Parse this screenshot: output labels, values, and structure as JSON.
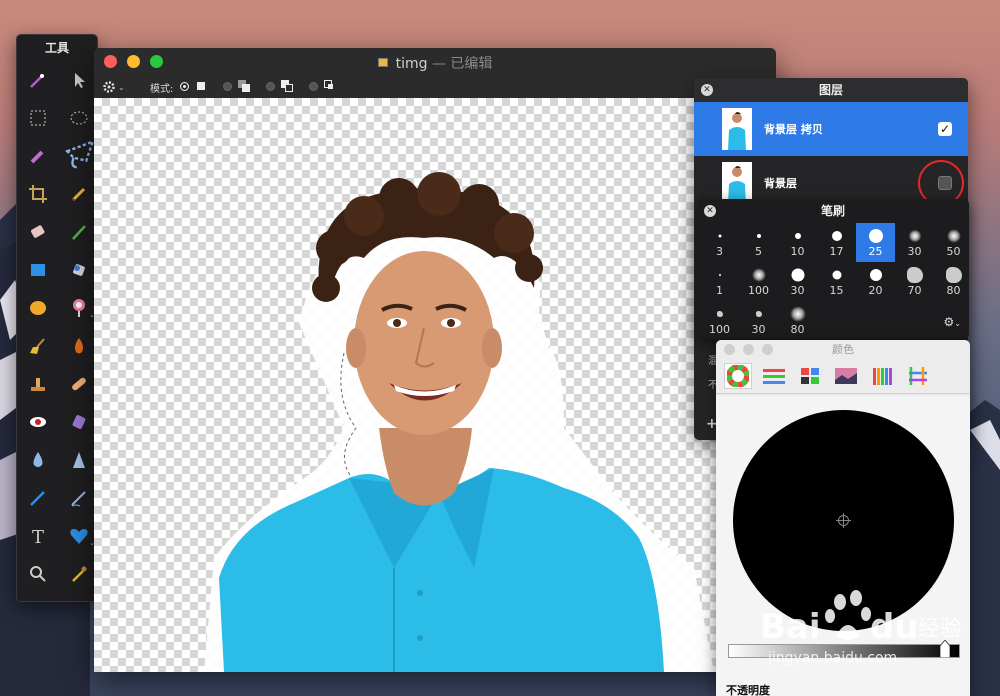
{
  "tools_palette": {
    "title": "工具",
    "tools": [
      "magic-wand-icon",
      "arrow-select-icon",
      "rect-select-icon",
      "ellipse-select-icon",
      "quick-select-icon",
      "lasso-icon",
      "crop-icon",
      "pencil-icon",
      "eraser-icon",
      "brush-icon",
      "rectangle-shape-icon",
      "fill-bucket-icon",
      "ellipse-shape-icon",
      "color-picker-lollipop-icon",
      "broom-icon",
      "burn-icon",
      "clone-stamp-icon",
      "bandage-icon",
      "red-eye-icon",
      "eraser-3d-icon",
      "blur-drop-icon",
      "sharpen-icon",
      "pen-icon",
      "smudge-icon",
      "text-icon",
      "heart-shape-icon",
      "zoom-icon",
      "eyedropper-icon"
    ]
  },
  "window": {
    "title": "timg",
    "edited_suffix": " — 已编辑",
    "options_bar": {
      "mode_label": "模式:"
    }
  },
  "layers_panel": {
    "title": "图层",
    "layers": [
      {
        "name": "背景层 拷贝",
        "visible": true,
        "selected": true
      },
      {
        "name": "背景层",
        "visible": false,
        "selected": false
      }
    ],
    "partial_labels": [
      "混",
      "不"
    ],
    "add_symbol": "+"
  },
  "brushes_panel": {
    "title": "笔刷",
    "brushes": [
      {
        "size": "3",
        "style": "hard"
      },
      {
        "size": "5",
        "style": "hard"
      },
      {
        "size": "10",
        "style": "hard"
      },
      {
        "size": "17",
        "style": "hard"
      },
      {
        "size": "25",
        "style": "hard",
        "selected": true
      },
      {
        "size": "30",
        "style": "soft"
      },
      {
        "size": "50",
        "style": "soft"
      },
      {
        "size": "1",
        "style": "hard"
      },
      {
        "size": "100",
        "style": "soft"
      },
      {
        "size": "30",
        "style": "hard"
      },
      {
        "size": "15",
        "style": "hard"
      },
      {
        "size": "20",
        "style": "hard"
      },
      {
        "size": "70",
        "style": "blob"
      },
      {
        "size": "80",
        "style": "blob"
      },
      {
        "size": "100",
        "style": "blob"
      },
      {
        "size": "30",
        "style": "blob"
      },
      {
        "size": "80",
        "style": "soft"
      }
    ],
    "gear_symbol": "⚙"
  },
  "colors_window": {
    "title": "颜色",
    "tabs": [
      "color-wheel-icon",
      "sliders-icon",
      "palettes-icon",
      "image-palette-icon",
      "crayons-icon",
      "pencils-icon"
    ],
    "current_color": "#000000",
    "opacity_label": "不透明度"
  },
  "watermark": {
    "brand": "Bai 经验",
    "url": "jingyan.baidu.com"
  },
  "accent_color": "#2e7ae6",
  "highlight_ring_color": "#e3282a"
}
